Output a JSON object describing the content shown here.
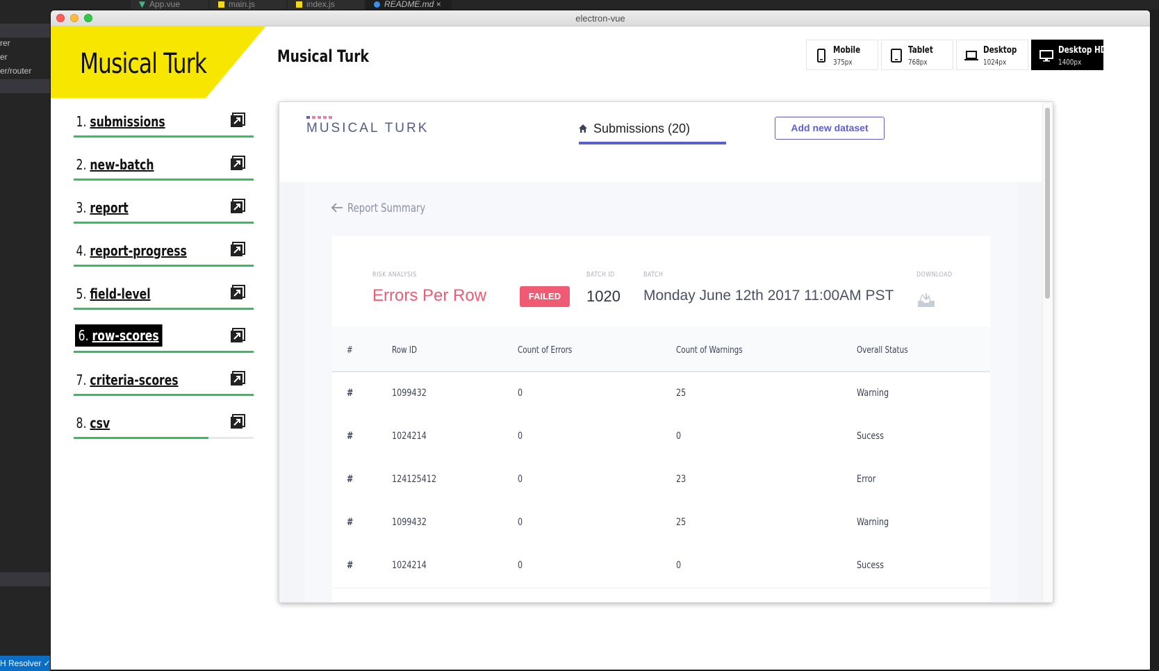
{
  "editor": {
    "tabs": [
      "App.vue",
      "main.js",
      "index.js",
      "README.md"
    ],
    "sidebar_lines": [
      "rer",
      "er",
      "er/router"
    ],
    "status_text": "H Resolver ✓"
  },
  "window": {
    "title": "electron-vue"
  },
  "showcase": {
    "brand": "Musical Turk",
    "title": "Musical Turk",
    "devices": [
      {
        "name": "Mobile",
        "size": "375px",
        "icon": "mobile-icon",
        "active": false
      },
      {
        "name": "Tablet",
        "size": "768px",
        "icon": "tablet-icon",
        "active": false
      },
      {
        "name": "Desktop",
        "size": "1024px",
        "icon": "laptop-icon",
        "active": false
      },
      {
        "name": "Desktop HD",
        "size": "1400px",
        "icon": "monitor-icon",
        "active": true
      }
    ],
    "nav": [
      {
        "num": "1.",
        "label": "submissions",
        "progress": 1.0
      },
      {
        "num": "2.",
        "label": "new-batch",
        "progress": 1.0
      },
      {
        "num": "3.",
        "label": "report",
        "progress": 1.0
      },
      {
        "num": "4.",
        "label": "report-progress",
        "progress": 1.0
      },
      {
        "num": "5.",
        "label": "field-level",
        "progress": 1.0
      },
      {
        "num": "6.",
        "label": "row-scores",
        "progress": 1.0,
        "active": true
      },
      {
        "num": "7.",
        "label": "criteria-scores",
        "progress": 1.0
      },
      {
        "num": "8.",
        "label": "csv",
        "progress": 0.75
      }
    ],
    "colors": {
      "accent": "#f7e600",
      "progress": "#31c05a"
    }
  },
  "app": {
    "logo_text": "MUSICAL TURK",
    "logo_dot_colors": [
      "#5a5fd1",
      "#f07ab0",
      "#f07ab0",
      "#f07ab0",
      "#f07ab0"
    ],
    "tab_submissions": "Submissions (20)",
    "add_dataset": "Add new dataset",
    "back_label": "Report Summary",
    "summary": {
      "risk_label": "RISK ANALYSIS",
      "risk_value": "Errors Per Row",
      "status_badge": "FAILED",
      "batch_id_label": "BATCH ID",
      "batch_id": "1020",
      "batch_label": "BATCH",
      "batch_value": "Monday June 12th 2017 11:00AM PST",
      "download_label": "DOWNLOAD"
    },
    "table": {
      "headers": [
        "#",
        "Row ID",
        "Count of Errors",
        "Count of Warnings",
        "Overall Status"
      ],
      "rows": [
        [
          "#",
          "1099432",
          "0",
          "25",
          "Warning"
        ],
        [
          "#",
          "1024214",
          "0",
          "0",
          "Sucess"
        ],
        [
          "#",
          "124125412",
          "0",
          "23",
          "Error"
        ],
        [
          "#",
          "1099432",
          "0",
          "25",
          "Warning"
        ],
        [
          "#",
          "1024214",
          "0",
          "0",
          "Sucess"
        ]
      ]
    },
    "colors": {
      "brand_purple": "#5a5fd1",
      "error_red": "#f05b73"
    }
  }
}
